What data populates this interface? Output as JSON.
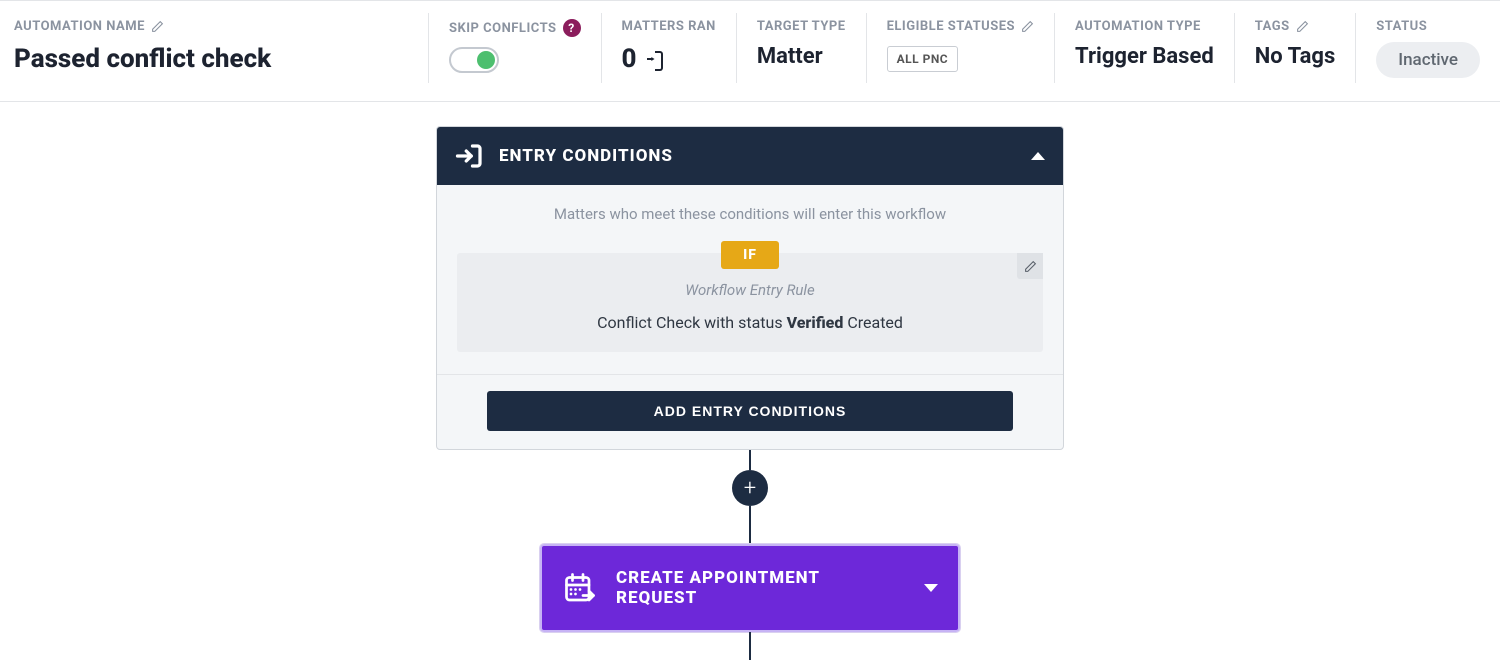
{
  "header": {
    "automation_name": {
      "label": "AUTOMATION NAME",
      "value": "Passed conflict check"
    },
    "skip_conflicts": {
      "label": "SKIP CONFLICTS"
    },
    "matters_ran": {
      "label": "MATTERS RAN",
      "value": "0"
    },
    "target_type": {
      "label": "TARGET TYPE",
      "value": "Matter"
    },
    "eligible_statuses": {
      "label": "ELIGIBLE STATUSES",
      "chip": "ALL PNC"
    },
    "automation_type": {
      "label": "AUTOMATION TYPE",
      "value": "Trigger Based"
    },
    "tags": {
      "label": "TAGS",
      "value": "No Tags"
    },
    "status": {
      "label": "STATUS",
      "value": "Inactive"
    }
  },
  "entry": {
    "title": "ENTRY CONDITIONS",
    "description": "Matters who meet these conditions will enter this workflow",
    "if_label": "IF",
    "rule_title": "Workflow Entry Rule",
    "rule_pre": "Conflict Check with status ",
    "rule_bold": "Verified",
    "rule_post": " Created",
    "add_button": "ADD ENTRY CONDITIONS"
  },
  "step1": {
    "label": "CREATE APPOINTMENT REQUEST"
  },
  "icons": {
    "help": "?",
    "plus": "+"
  }
}
